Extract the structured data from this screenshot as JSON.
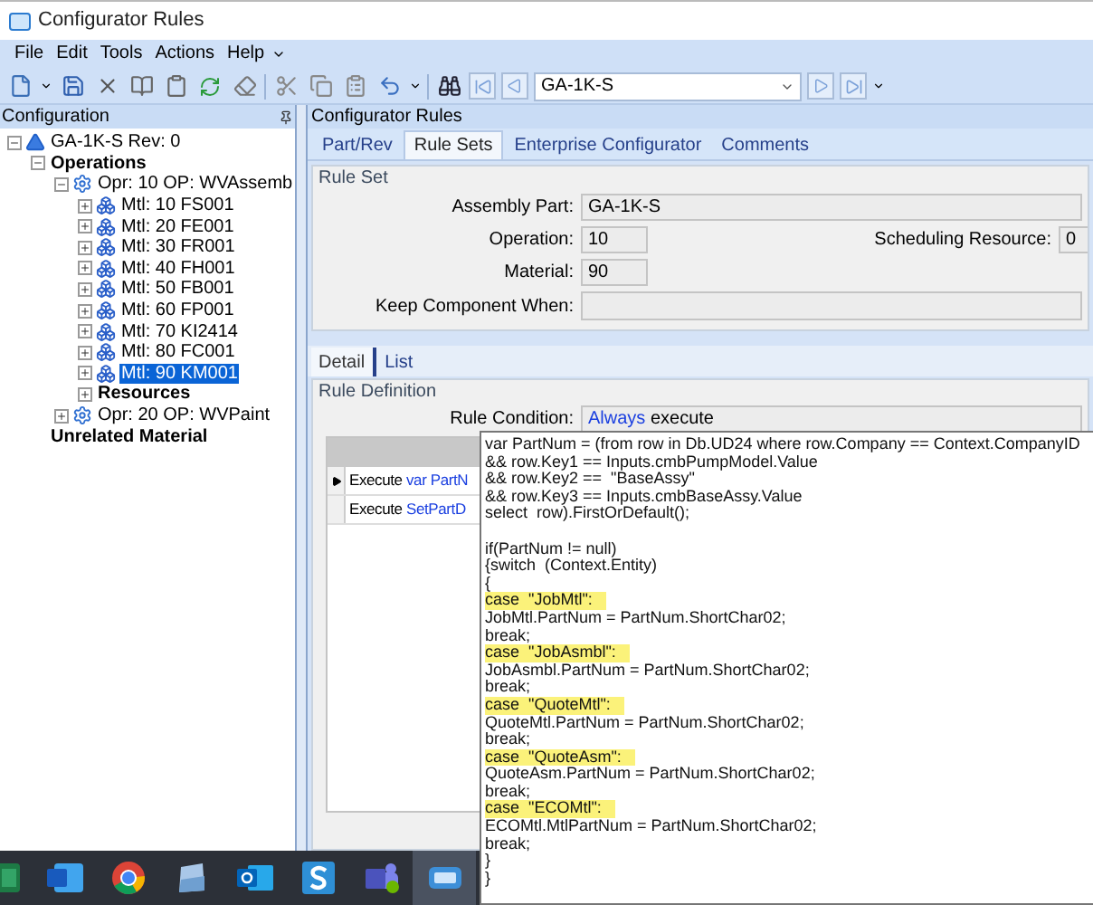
{
  "window": {
    "title": "Configurator Rules"
  },
  "menu": [
    {
      "label": "File"
    },
    {
      "label": "Edit"
    },
    {
      "label": "Tools"
    },
    {
      "label": "Actions"
    },
    {
      "label": "Help"
    }
  ],
  "toolbar": {
    "part_combo": {
      "value": "GA-1K-S"
    }
  },
  "sidebar": {
    "title": "Configuration",
    "tree": [
      {
        "label": "GA-1K-S Rev: 0",
        "kind": "assembly",
        "expanded": true,
        "selected": false,
        "children": [
          {
            "label": "Operations",
            "kind": "group",
            "expanded": true,
            "selected": false,
            "children": [
              {
                "label": "Opr: 10 OP: WVAssemb",
                "kind": "operation",
                "expanded": true,
                "selected": false,
                "children": [
                  {
                    "label": "Mtl: 10 FS001",
                    "kind": "material",
                    "expanded": false,
                    "selected": false
                  },
                  {
                    "label": "Mtl: 20 FE001",
                    "kind": "material",
                    "expanded": false,
                    "selected": false
                  },
                  {
                    "label": "Mtl: 30 FR001",
                    "kind": "material",
                    "expanded": false,
                    "selected": false
                  },
                  {
                    "label": "Mtl: 40 FH001",
                    "kind": "material",
                    "expanded": false,
                    "selected": false
                  },
                  {
                    "label": "Mtl: 50 FB001",
                    "kind": "material",
                    "expanded": false,
                    "selected": false
                  },
                  {
                    "label": "Mtl: 60 FP001",
                    "kind": "material",
                    "expanded": false,
                    "selected": false
                  },
                  {
                    "label": "Mtl: 70 KI2414",
                    "kind": "material",
                    "expanded": false,
                    "selected": false
                  },
                  {
                    "label": "Mtl: 80 FC001",
                    "kind": "material",
                    "expanded": false,
                    "selected": false
                  },
                  {
                    "label": "Mtl: 90 KM001",
                    "kind": "material",
                    "expanded": false,
                    "selected": true
                  },
                  {
                    "label": "Resources",
                    "kind": "group",
                    "expanded": false,
                    "selected": false
                  }
                ]
              },
              {
                "label": "Opr: 20 OP: WVPaint",
                "kind": "operation",
                "expanded": false,
                "selected": false
              }
            ]
          },
          {
            "label": "Unrelated Material",
            "kind": "group",
            "selected": false
          }
        ]
      }
    ]
  },
  "panel": {
    "title": "Configurator Rules",
    "tabs": [
      {
        "label": "Part/Rev",
        "selected": false
      },
      {
        "label": "Rule Sets",
        "selected": true
      },
      {
        "label": "Enterprise Configurator",
        "selected": false
      },
      {
        "label": "Comments",
        "selected": false
      }
    ],
    "rule_set": {
      "title": "Rule Set",
      "assembly_part": {
        "label": "Assembly Part:",
        "value": "GA-1K-S"
      },
      "operation": {
        "label": "Operation:",
        "value": "10"
      },
      "material": {
        "label": "Material:",
        "value": "90"
      },
      "keep_component_when": {
        "label": "Keep Component When:"
      },
      "scheduling_resource": {
        "label": "Scheduling Resource:",
        "value": "0"
      }
    },
    "sub_tabs": [
      {
        "label": "Detail",
        "selected": true
      },
      {
        "label": "List",
        "selected": false
      }
    ],
    "rule_definition": {
      "title": "Rule Definition",
      "rule_condition": {
        "label": "Rule Condition:",
        "keyword": "Always",
        "text": "execute"
      },
      "rows": [
        {
          "verb": "Execute",
          "code": "var PartN",
          "current": true
        },
        {
          "verb": "Execute",
          "code": "SetPartD",
          "current": false
        }
      ]
    },
    "code_tooltip": {
      "blocks": [
        [
          {
            "text": "var PartNum = (from row in Db.UD24 where row.Company == Context.CompanyID",
            "highlighted": false
          },
          {
            "text": "&& row.Key1 == Inputs.cmbPumpModel.Value",
            "highlighted": false
          },
          {
            "text": "&& row.Key2 ==  \"BaseAssy\"",
            "highlighted": false
          },
          {
            "text": "&& row.Key3 == Inputs.cmbBaseAssy.Value",
            "highlighted": false
          },
          {
            "text": "select  row).FirstOrDefault();",
            "highlighted": false
          }
        ],
        [
          {
            "text": "if(PartNum != null)",
            "highlighted": false
          },
          {
            "text": "{switch  (Context.Entity)",
            "highlighted": false
          },
          {
            "text": "{",
            "highlighted": false
          },
          {
            "text": "case  \"JobMtl\":",
            "highlighted": true
          },
          {
            "text": "JobMtl.PartNum = PartNum.ShortChar02;",
            "highlighted": false
          },
          {
            "text": "break;",
            "highlighted": false
          },
          {
            "text": "case  \"JobAsmbl\":",
            "highlighted": true
          },
          {
            "text": "JobAsmbl.PartNum = PartNum.ShortChar02;",
            "highlighted": false
          },
          {
            "text": "break;",
            "highlighted": false
          },
          {
            "text": "case  \"QuoteMtl\":",
            "highlighted": true
          },
          {
            "text": "QuoteMtl.PartNum = PartNum.ShortChar02;",
            "highlighted": false
          },
          {
            "text": "break;",
            "highlighted": false
          },
          {
            "text": "case  \"QuoteAsm\":",
            "highlighted": true
          },
          {
            "text": "QuoteAsm.PartNum = PartNum.ShortChar02;",
            "highlighted": false
          },
          {
            "text": "break;",
            "highlighted": false
          },
          {
            "text": "case  \"ECOMtl\":",
            "highlighted": true
          },
          {
            "text": "ECOMtl.MtlPartNum = PartNum.ShortChar02;",
            "highlighted": false
          },
          {
            "text": "break;",
            "highlighted": false
          },
          {
            "text": "}",
            "highlighted": false
          },
          {
            "text": "}",
            "highlighted": false
          }
        ]
      ]
    }
  },
  "taskbar": [
    {
      "kind": "sheet",
      "selected": false
    },
    {
      "kind": "doc",
      "selected": false
    },
    {
      "kind": "browser",
      "selected": false
    },
    {
      "kind": "viewer",
      "selected": false
    },
    {
      "kind": "mail",
      "selected": false
    },
    {
      "kind": "s-app",
      "selected": false
    },
    {
      "kind": "chat",
      "selected": false
    },
    {
      "kind": "erp",
      "selected": true
    }
  ]
}
